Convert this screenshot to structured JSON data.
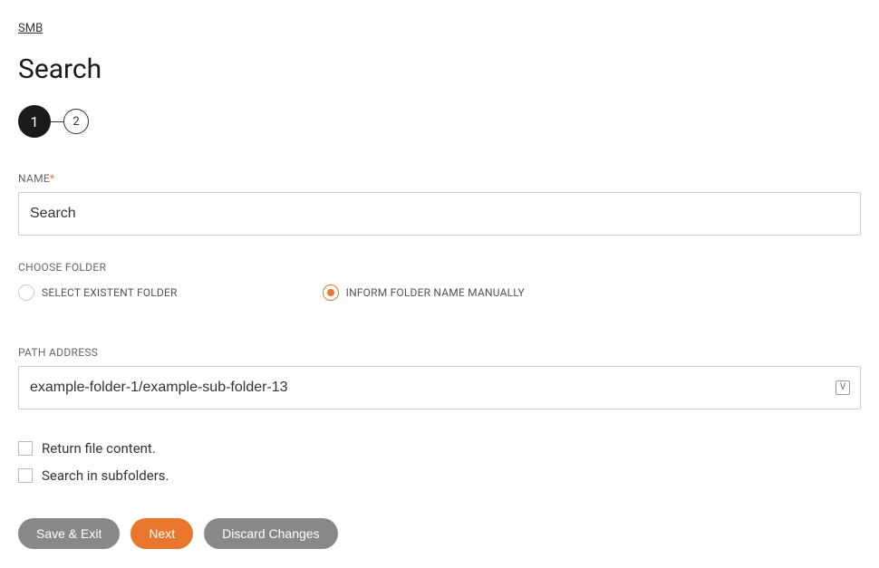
{
  "breadcrumb": "SMB",
  "page_title": "Search",
  "stepper": {
    "steps": [
      "1",
      "2"
    ],
    "active_index": 0
  },
  "fields": {
    "name": {
      "label": "NAME",
      "required_mark": "*",
      "value": "Search"
    },
    "choose_folder": {
      "label": "CHOOSE FOLDER",
      "options": {
        "select_existent": "SELECT EXISTENT FOLDER",
        "inform_manually": "INFORM FOLDER NAME MANUALLY"
      },
      "selected": "inform_manually"
    },
    "path_address": {
      "label": "PATH ADDRESS",
      "value": "example-folder-1/example-sub-folder-13",
      "suffix_icon_glyph": "V"
    },
    "return_file_content": {
      "label": "Return file content.",
      "checked": false
    },
    "search_subfolders": {
      "label": "Search in subfolders.",
      "checked": false
    }
  },
  "buttons": {
    "save_exit": "Save & Exit",
    "next": "Next",
    "discard": "Discard Changes"
  }
}
